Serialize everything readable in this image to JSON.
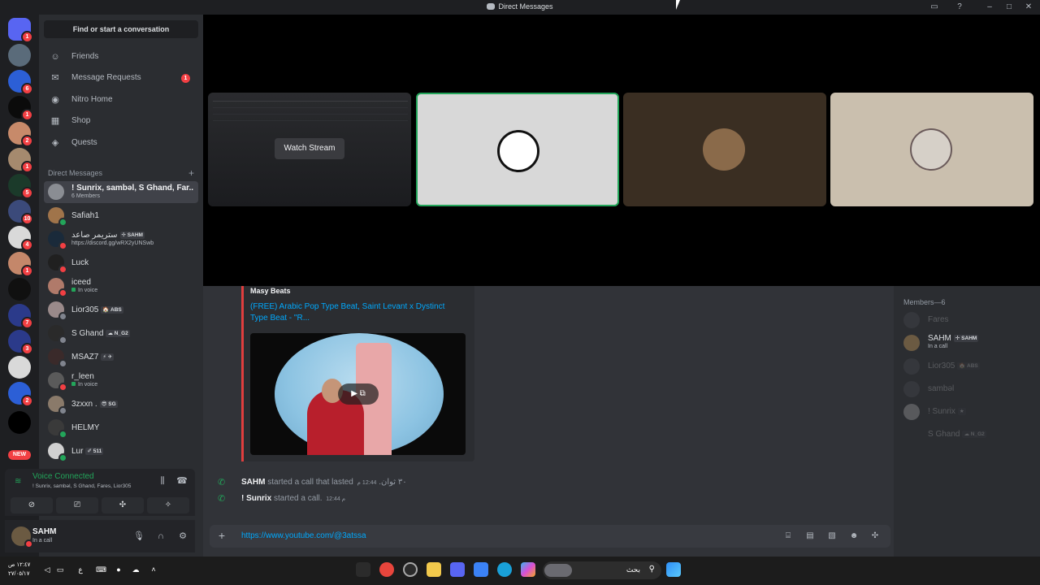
{
  "window": {
    "title": "Direct Messages"
  },
  "rail": {
    "badges": [
      "1",
      "",
      "6",
      "1",
      "2",
      "1",
      "5",
      "10",
      "4",
      "1",
      "",
      "7",
      "3",
      "",
      "2",
      ""
    ],
    "new_label": "NEW"
  },
  "sidebar": {
    "find_label": "Find or start a conversation",
    "nav": [
      {
        "label": "Friends",
        "icon": "friends-icon"
      },
      {
        "label": "Message Requests",
        "icon": "mail-icon",
        "badge": "1"
      },
      {
        "label": "Nitro Home",
        "icon": "nitro-icon"
      },
      {
        "label": "Shop",
        "icon": "shop-icon"
      },
      {
        "label": "Quests",
        "icon": "quests-icon"
      }
    ],
    "dm_header": "Direct Messages",
    "dms": [
      {
        "name": "! Sunrix, sambəl, S Ghand, Far...",
        "sub": "6 Members"
      },
      {
        "name": "Safiah1"
      },
      {
        "name": "ستريمر صاعد",
        "tag": "✢ SAHM",
        "sub": "https://discord.gg/wRX2yUNSwb"
      },
      {
        "name": "Luck"
      },
      {
        "name": "iceed",
        "sub": "In voice"
      },
      {
        "name": "Lior305",
        "tag": "🏠 ABS"
      },
      {
        "name": "S Ghand",
        "tag": "☁ N_G2"
      },
      {
        "name": "MSAZ7",
        "tag": "⚡ ✈"
      },
      {
        "name": "r_leen",
        "sub": "In voice"
      },
      {
        "name": "3zxxn .",
        "tag": "😎 SG"
      },
      {
        "name": "HELMY"
      },
      {
        "name": "Lur",
        "tag": "✐ 511"
      }
    ]
  },
  "voice": {
    "status": "Voice Connected",
    "channel": "! Sunrix, sambəl, S Ghand, Fares, Lior305"
  },
  "user": {
    "name": "SAHM",
    "status": "In a call"
  },
  "stage": {
    "watch_label": "Watch Stream"
  },
  "embed": {
    "provider": "Masy Beats",
    "title": "(FREE) Arabic Pop Type Beat, Saint Levant x Dystinct Type Beat - \"R..."
  },
  "messages": [
    {
      "author": "SAHM",
      "text": "started a call that lasted ٣٠ ثوان.",
      "time": "12:44 م"
    },
    {
      "author": "! Sunrix",
      "text": "started a call.",
      "time": "12:44 م"
    }
  ],
  "composer": {
    "value": "https://www.youtube.com/@3atssa"
  },
  "members": {
    "header": "Members—6",
    "list": [
      {
        "name": "Fares",
        "online": false
      },
      {
        "name": "SAHM",
        "tag": "✢ SAHM",
        "sub": "In a call",
        "online": true
      },
      {
        "name": "Lior305",
        "tag": "🏠 ABS",
        "online": false
      },
      {
        "name": "sambəl",
        "online": false
      },
      {
        "name": "! Sunrix",
        "tag": "★",
        "online": false
      },
      {
        "name": "S Ghand",
        "tag": "☁ N_G2",
        "online": false
      }
    ]
  },
  "taskbar": {
    "time": "١٢:٤٧ ص",
    "date": "٢٧/٠٥/١٧",
    "lang": "ع",
    "search_value": "بحث"
  }
}
